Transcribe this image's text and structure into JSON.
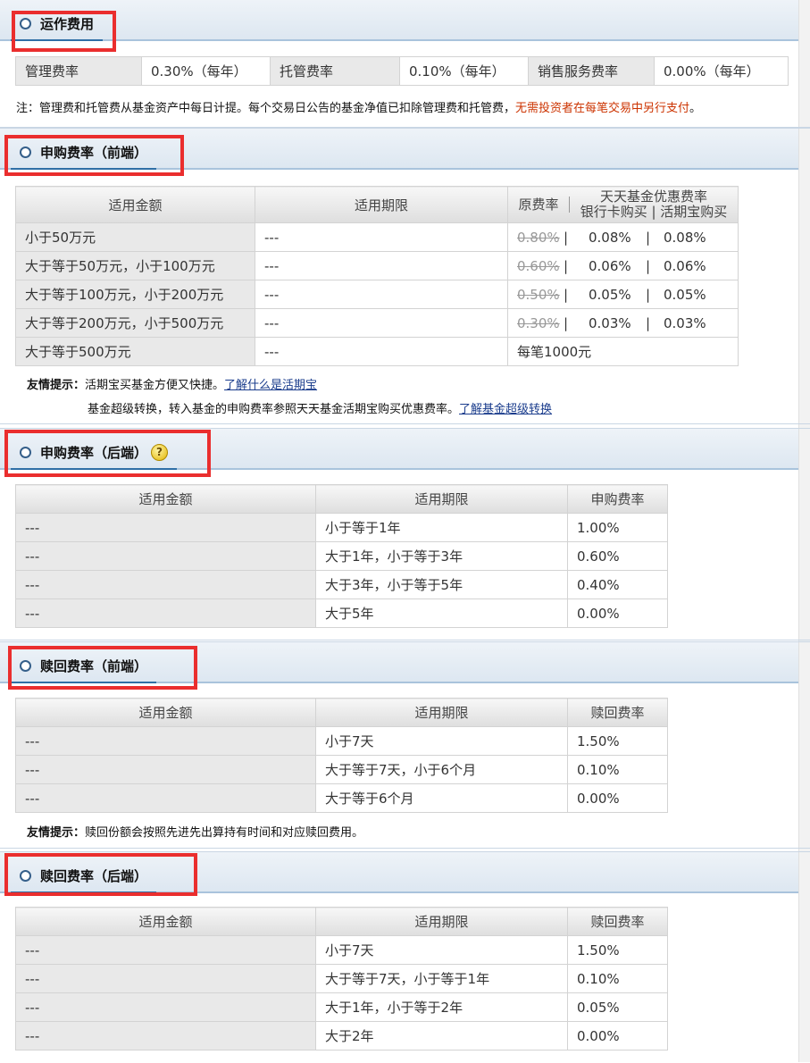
{
  "op": {
    "title": "运作费用",
    "rows": [
      [
        "管理费率",
        "0.30%（每年）",
        "托管费率",
        "0.10%（每年）",
        "销售服务费率",
        "0.00%（每年）"
      ]
    ],
    "note_prefix": "注：管理费和托管费从基金资产中每日计提。每个交易日公告的基金净值已扣除管理费和托管费，",
    "note_red": "无需投资者在每笔交易中另行支付",
    "note_suffix": "。"
  },
  "front": {
    "title": "申购费率（前端）",
    "h_amount": "适用金额",
    "h_period": "适用期限",
    "h_orig": "原费率",
    "h_tt": "天天基金优惠费率",
    "h_bank": "银行卡购买",
    "h_hqb": "活期宝购买",
    "rows": [
      {
        "amount": "小于50万元",
        "period": "---",
        "orig": "0.80%",
        "bank": "0.08%",
        "hqb": "0.08%"
      },
      {
        "amount": "大于等于50万元，小于100万元",
        "period": "---",
        "orig": "0.60%",
        "bank": "0.06%",
        "hqb": "0.06%"
      },
      {
        "amount": "大于等于100万元，小于200万元",
        "period": "---",
        "orig": "0.50%",
        "bank": "0.05%",
        "hqb": "0.05%"
      },
      {
        "amount": "大于等于200万元，小于500万元",
        "period": "---",
        "orig": "0.30%",
        "bank": "0.03%",
        "hqb": "0.03%"
      },
      {
        "amount": "大于等于500万元",
        "period": "---",
        "fixed": "每笔1000元"
      }
    ],
    "tip_label": "友情提示：",
    "tip1_text": "活期宝买基金方便又快捷。",
    "tip1_link": "了解什么是活期宝",
    "tip2_text": "基金超级转换，转入基金的申购费率参照天天基金活期宝购买优惠费率。",
    "tip2_link": "了解基金超级转换"
  },
  "back": {
    "title": "申购费率（后端）",
    "help": "?",
    "headers": [
      "适用金额",
      "适用期限",
      "申购费率"
    ],
    "rows": [
      [
        "---",
        "小于等于1年",
        "1.00%"
      ],
      [
        "---",
        "大于1年，小于等于3年",
        "0.60%"
      ],
      [
        "---",
        "大于3年，小于等于5年",
        "0.40%"
      ],
      [
        "---",
        "大于5年",
        "0.00%"
      ]
    ]
  },
  "redeem_front": {
    "title": "赎回费率（前端）",
    "headers": [
      "适用金额",
      "适用期限",
      "赎回费率"
    ],
    "rows": [
      [
        "---",
        "小于7天",
        "1.50%"
      ],
      [
        "---",
        "大于等于7天，小于6个月",
        "0.10%"
      ],
      [
        "---",
        "大于等于6个月",
        "0.00%"
      ]
    ],
    "tip_label": "友情提示：",
    "tip_text": "赎回份额会按照先进先出算持有时间和对应赎回费用。"
  },
  "redeem_back": {
    "title": "赎回费率（后端）",
    "headers": [
      "适用金额",
      "适用期限",
      "赎回费率"
    ],
    "rows": [
      [
        "---",
        "小于7天",
        "1.50%"
      ],
      [
        "---",
        "大于等于7天，小于等于1年",
        "0.10%"
      ],
      [
        "---",
        "大于1年，小于等于2年",
        "0.05%"
      ],
      [
        "---",
        "大于2年",
        "0.00%"
      ]
    ]
  },
  "colors": {
    "highlight": "#ea2e2e",
    "accent_line": "#2f6fa6",
    "link": "#1a3c8c",
    "notice": "#cc3300"
  }
}
